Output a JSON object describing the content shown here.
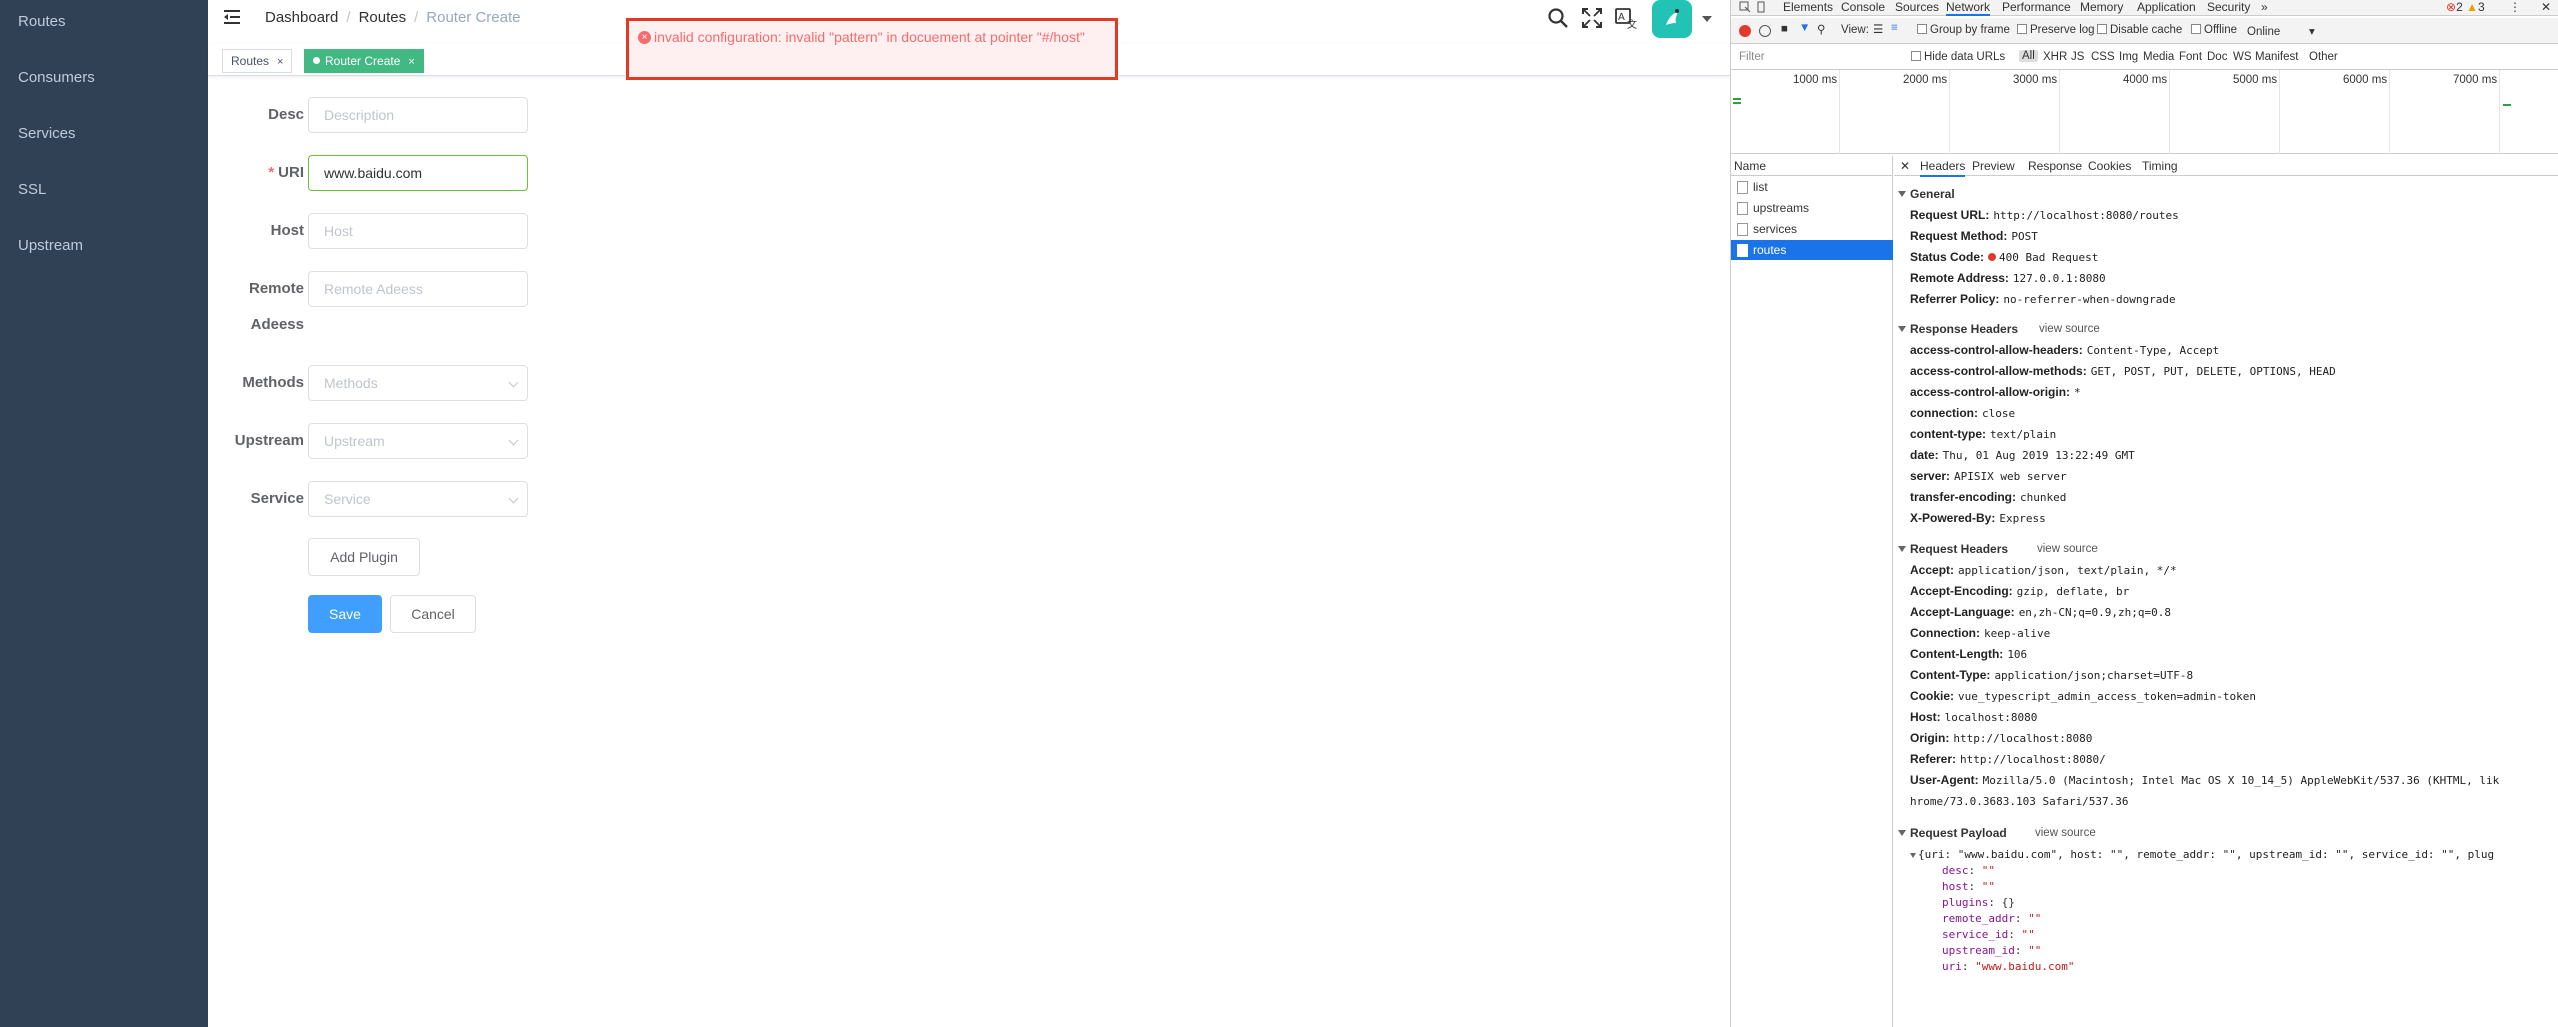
{
  "sidebar": {
    "items": [
      {
        "label": "Routes"
      },
      {
        "label": "Consumers"
      },
      {
        "label": "Services"
      },
      {
        "label": "SSL"
      },
      {
        "label": "Upstream"
      }
    ]
  },
  "breadcrumb": {
    "items": [
      "Dashboard",
      "Routes",
      "Router Create"
    ]
  },
  "tags": {
    "routes": "Routes",
    "router_create": "Router Create"
  },
  "error_toast": {
    "message": "invalid configuration: invalid \"pattern\" in docuement at pointer \"#/host\""
  },
  "form": {
    "desc": {
      "label": "Desc",
      "placeholder": "Description"
    },
    "uri": {
      "label": "URI",
      "value": "www.baidu.com"
    },
    "host": {
      "label": "Host",
      "placeholder": "Host"
    },
    "remote": {
      "label_line1": "Remote",
      "label_line2": "Adeess",
      "placeholder": "Remote Adeess"
    },
    "methods": {
      "label": "Methods",
      "placeholder": "Methods"
    },
    "upstream": {
      "label": "Upstream",
      "placeholder": "Upstream"
    },
    "service": {
      "label": "Service",
      "placeholder": "Service"
    },
    "add_plugin": "Add Plugin",
    "save": "Save",
    "cancel": "Cancel"
  },
  "devtools": {
    "tabs": [
      "Elements",
      "Console",
      "Sources",
      "Network",
      "Performance",
      "Memory",
      "Application",
      "Security"
    ],
    "errors": "2",
    "warnings": "3",
    "toolbar": {
      "view": "View:",
      "group_by_frame": "Group by frame",
      "preserve_log": "Preserve log",
      "disable_cache": "Disable cache",
      "offline": "Offline",
      "throttle": "Online"
    },
    "filter": {
      "placeholder": "Filter",
      "hide_data_urls": "Hide data URLs",
      "types": [
        "All",
        "XHR",
        "JS",
        "CSS",
        "Img",
        "Media",
        "Font",
        "Doc",
        "WS",
        "Manifest",
        "Other"
      ]
    },
    "timeline": [
      "1000 ms",
      "2000 ms",
      "3000 ms",
      "4000 ms",
      "5000 ms",
      "6000 ms",
      "7000 ms"
    ],
    "name_header": "Name",
    "requests": [
      "list",
      "upstreams",
      "services",
      "routes"
    ],
    "detail_tabs": [
      "Headers",
      "Preview",
      "Response",
      "Cookies",
      "Timing"
    ],
    "general_title": "General",
    "general": [
      {
        "k": "Request URL:",
        "v": "http://localhost:8080/routes"
      },
      {
        "k": "Request Method:",
        "v": "POST"
      },
      {
        "k": "Status Code:",
        "v": "400 Bad Request"
      },
      {
        "k": "Remote Address:",
        "v": "127.0.0.1:8080"
      },
      {
        "k": "Referrer Policy:",
        "v": "no-referrer-when-downgrade"
      }
    ],
    "response_title": "Response Headers",
    "view_source": "view source",
    "response_headers": [
      {
        "k": "access-control-allow-headers:",
        "v": "Content-Type, Accept"
      },
      {
        "k": "access-control-allow-methods:",
        "v": "GET, POST, PUT, DELETE, OPTIONS, HEAD"
      },
      {
        "k": "access-control-allow-origin:",
        "v": "*"
      },
      {
        "k": "connection:",
        "v": "close"
      },
      {
        "k": "content-type:",
        "v": "text/plain"
      },
      {
        "k": "date:",
        "v": "Thu, 01 Aug 2019 13:22:49 GMT"
      },
      {
        "k": "server:",
        "v": "APISIX web server"
      },
      {
        "k": "transfer-encoding:",
        "v": "chunked"
      },
      {
        "k": "X-Powered-By:",
        "v": "Express"
      }
    ],
    "request_title": "Request Headers",
    "request_headers": [
      {
        "k": "Accept:",
        "v": "application/json, text/plain, */*"
      },
      {
        "k": "Accept-Encoding:",
        "v": "gzip, deflate, br"
      },
      {
        "k": "Accept-Language:",
        "v": "en,zh-CN;q=0.9,zh;q=0.8"
      },
      {
        "k": "Connection:",
        "v": "keep-alive"
      },
      {
        "k": "Content-Length:",
        "v": "106"
      },
      {
        "k": "Content-Type:",
        "v": "application/json;charset=UTF-8"
      },
      {
        "k": "Cookie:",
        "v": "vue_typescript_admin_access_token=admin-token"
      },
      {
        "k": "Host:",
        "v": "localhost:8080"
      },
      {
        "k": "Origin:",
        "v": "http://localhost:8080"
      },
      {
        "k": "Referer:",
        "v": "http://localhost:8080/"
      },
      {
        "k": "User-Agent:",
        "v": "Mozilla/5.0 (Macintosh; Intel Mac OS X 10_14_5) AppleWebKit/537.36 (KHTML, lik"
      }
    ],
    "user_agent_cont": "hrome/73.0.3683.103 Safari/537.36",
    "payload_title": "Request Payload",
    "payload_summary": "{uri: \"www.baidu.com\", host: \"\", remote_addr: \"\", upstream_id: \"\", service_id: \"\", plug",
    "payload": [
      {
        "k": "desc",
        "v": "\"\""
      },
      {
        "k": "host",
        "v": "\"\""
      },
      {
        "k": "plugins",
        "v": "{}"
      },
      {
        "k": "remote_addr",
        "v": "\"\""
      },
      {
        "k": "service_id",
        "v": "\"\""
      },
      {
        "k": "upstream_id",
        "v": "\"\""
      },
      {
        "k": "uri",
        "v": "\"www.baidu.com\""
      }
    ]
  }
}
